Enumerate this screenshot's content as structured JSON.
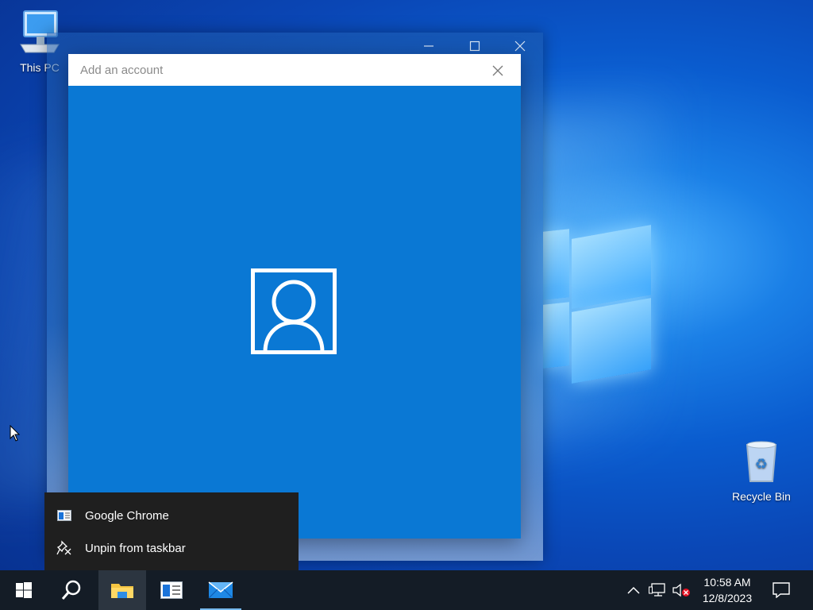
{
  "desktop": {
    "icons": [
      {
        "label": "This PC",
        "icon": "computer-icon"
      },
      {
        "label": "Recycle Bin",
        "icon": "recycle-bin-icon"
      }
    ]
  },
  "dialog": {
    "title": "Add an account",
    "close_icon": "close-icon",
    "avatar_icon": "person-account-icon",
    "accent_color": "#0a78d4"
  },
  "background_window": {
    "controls": [
      "minimize",
      "maximize",
      "close"
    ]
  },
  "context_menu": {
    "items": [
      {
        "label": "Google Chrome",
        "icon": "app-window-icon"
      },
      {
        "label": "Unpin from taskbar",
        "icon": "unpin-icon"
      }
    ]
  },
  "taskbar": {
    "buttons": [
      {
        "name": "start",
        "icon": "windows-start-icon"
      },
      {
        "name": "search",
        "icon": "search-icon"
      },
      {
        "name": "file-explorer",
        "icon": "folder-icon"
      },
      {
        "name": "google-chrome",
        "icon": "app-window-icon"
      },
      {
        "name": "mail",
        "icon": "mail-icon"
      }
    ],
    "tray": {
      "icons": [
        "chevron-up-icon",
        "network-icon",
        "volume-muted-icon",
        "notification-icon"
      ]
    },
    "clock": {
      "time": "10:58 AM",
      "date": "12/8/2023"
    }
  }
}
